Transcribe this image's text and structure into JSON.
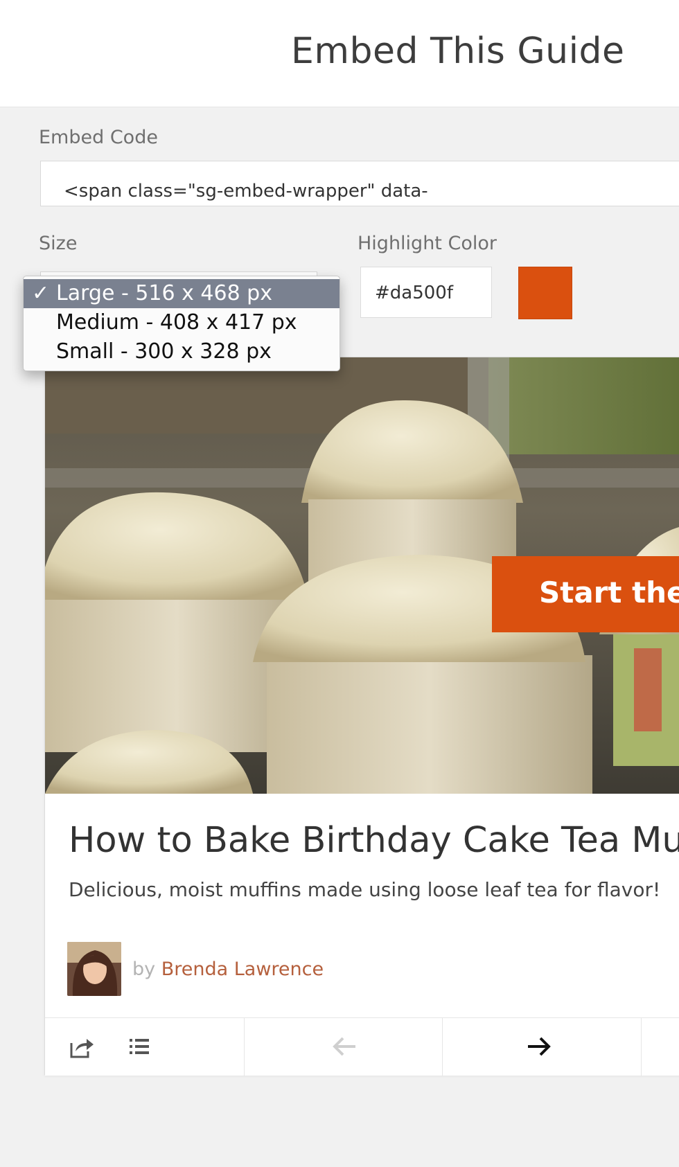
{
  "header": {
    "title": "Embed This Guide"
  },
  "embed": {
    "label": "Embed Code",
    "code": "<span class=\"sg-embed-wrapper\" data-"
  },
  "size": {
    "label": "Size",
    "options": [
      {
        "label": "Large - 516 x 468 px",
        "selected": true
      },
      {
        "label": "Medium - 408 x 417 px",
        "selected": false
      },
      {
        "label": "Small - 300 x 328 px",
        "selected": false
      }
    ],
    "check_glyph": "✓"
  },
  "highlight": {
    "label": "Highlight Color",
    "value": "#da500f",
    "swatch_color": "#da500f"
  },
  "preview": {
    "start_button": "Start the G",
    "title": "How to Bake Birthday Cake Tea Muf",
    "description": "Delicious, moist muffins made using loose leaf tea for flavor!",
    "by": "by",
    "author": "Brenda Lawrence",
    "toolbar_icons": [
      "share-icon",
      "list-icon",
      "arrow-left-icon",
      "arrow-right-icon"
    ]
  }
}
